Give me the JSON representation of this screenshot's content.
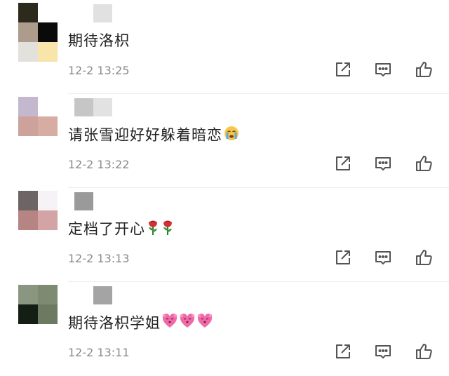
{
  "comments": [
    {
      "text": "期待洛枳",
      "time": "12-2 13:25",
      "avatar_colors": [
        "#2b2a1c",
        "#ffffff",
        "#ad9b8c",
        "#0a0a0a",
        "#e3e1dc",
        "#f8e5a9"
      ],
      "name_colors": [
        "#ffffff",
        "#e1e1e1"
      ],
      "emojis": []
    },
    {
      "text": "请张雪迎好好躲着暗恋",
      "time": "12-2 13:22",
      "avatar_colors": [
        "#c3b8cd",
        "#ffffff",
        "#cda29a",
        "#d7ada3",
        "#ffffff",
        "#ffffff"
      ],
      "name_colors": [
        "#c6c6c6",
        "#e2e2e2"
      ],
      "emojis": [
        "crying-face-icon"
      ]
    },
    {
      "text": "定档了开心",
      "time": "12-2 13:13",
      "avatar_colors": [
        "#6c6564",
        "#f5f3f5",
        "#b78484",
        "#d3a3a5",
        "#ffffff",
        "#ffffff"
      ],
      "name_colors": [
        "#9a9a9a",
        "#ffffff"
      ],
      "emojis": [
        "rose-icon",
        "rose-icon"
      ]
    },
    {
      "text": "期待洛枳学姐",
      "time": "12-2 13:11",
      "avatar_colors": [
        "#8a9680",
        "#7d8b72",
        "#151e14",
        "#6b7a60",
        "#ffffff",
        "#ffffff"
      ],
      "name_colors": [
        "#ffffff",
        "#a4a4a4"
      ],
      "emojis": [
        "heart-face-icon",
        "heart-face-icon",
        "heart-face-icon"
      ]
    }
  ],
  "actions": [
    "share-icon",
    "comment-icon",
    "like-icon"
  ],
  "colors": {
    "text": "#222222",
    "time": "#8a8a8a",
    "icon": "#555555",
    "divider": "#ededed"
  }
}
